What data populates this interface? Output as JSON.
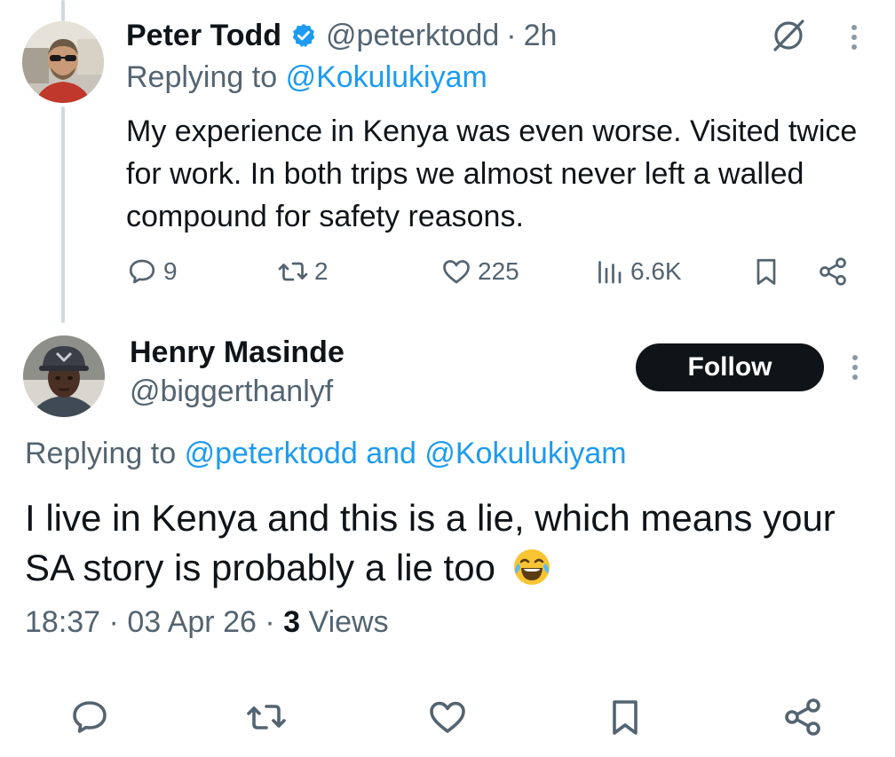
{
  "tweet1": {
    "author_name": "Peter Todd",
    "handle": "@peterktodd",
    "separator": "·",
    "time_ago": "2h",
    "replying_prefix": "Replying to",
    "replying_mention": "@Kokulukiyam",
    "body": "My experience in Kenya was even worse. Visited twice for work. In both trips we almost never left a walled compound for safety reasons.",
    "actions": {
      "replies": "9",
      "retweets": "2",
      "likes": "225",
      "views": "6.6K"
    },
    "icons": [
      "verified-badge-icon",
      "grok-icon",
      "more-icon",
      "reply-icon",
      "retweet-icon",
      "like-icon",
      "views-icon",
      "bookmark-icon",
      "share-icon"
    ]
  },
  "tweet2": {
    "author_name": "Henry Masinde",
    "handle": "@biggerthanlyf",
    "follow_label": "Follow",
    "replying_prefix": "Replying to",
    "replying_mentions": "@peterktodd and @Kokulukiyam",
    "body": "I live in Kenya and this is a lie, which means your SA story is probably a lie too",
    "emoji": "😂",
    "time": "18:37",
    "separator": "·",
    "date": "03 Apr 26",
    "views_count": "3",
    "views_label": "Views"
  },
  "colors": {
    "text": "#0f1419",
    "secondary": "#536471",
    "accent": "#1d9bf0",
    "thread_line": "#cfd9de",
    "follow_bg": "#0f1419",
    "follow_text": "#ffffff"
  }
}
